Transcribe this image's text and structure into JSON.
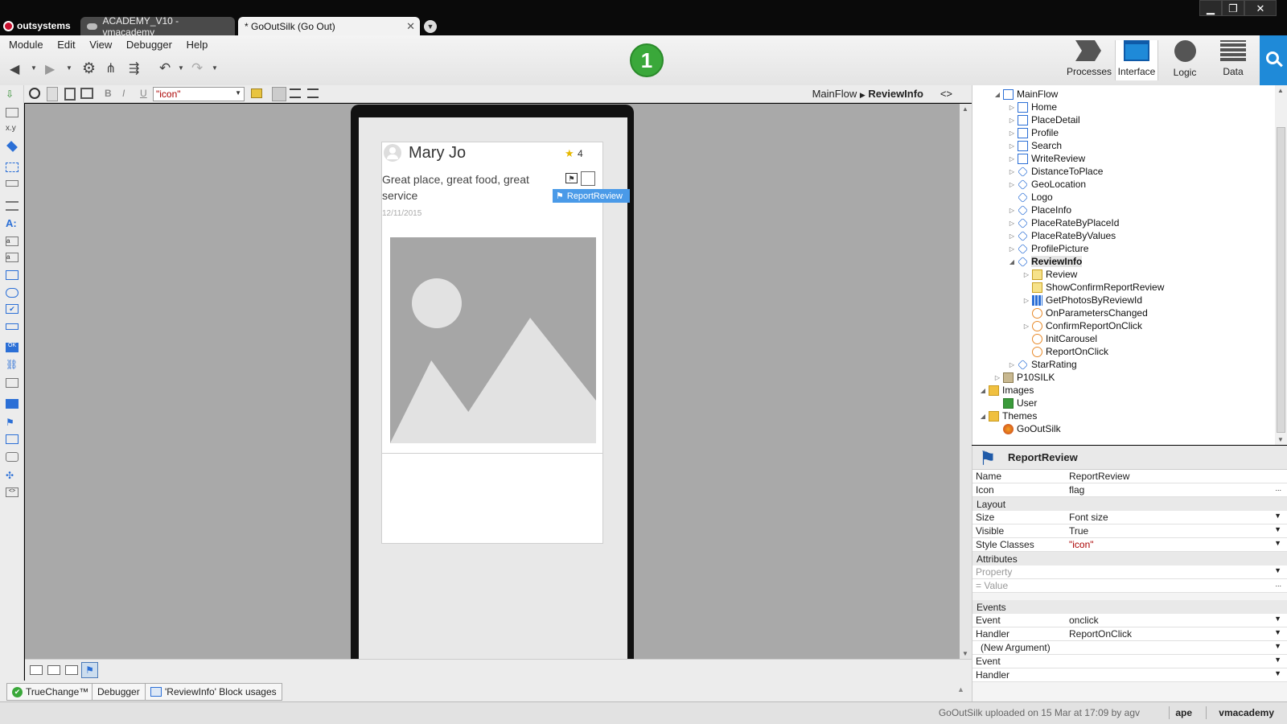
{
  "app": {
    "brand": "outsystems",
    "accent": "#1f8ad8",
    "brand_color": "#c8102e"
  },
  "tabs": [
    {
      "label": "ACADEMY_V10 - vmacademy"
    },
    {
      "label": "* GoOutSilk (Go Out)"
    }
  ],
  "menu": {
    "module": "Module",
    "edit": "Edit",
    "view": "View",
    "debugger": "Debugger",
    "help": "Help"
  },
  "badge": {
    "value": "1",
    "color": "#3aa83a"
  },
  "topnav": [
    {
      "label": "Processes",
      "icon": "processes-icon"
    },
    {
      "label": "Interface",
      "icon": "interface-icon"
    },
    {
      "label": "Logic",
      "icon": "logic-icon"
    },
    {
      "label": "Data",
      "icon": "data-icon"
    }
  ],
  "format_bar": {
    "style_value": "\"icon\"",
    "bold": "B",
    "italic": "I",
    "underline": "U"
  },
  "breadcrumb": {
    "flow": "MainFlow",
    "current": "ReviewInfo",
    "toggle": "<>"
  },
  "preview": {
    "user_name": "Mary Jo",
    "rating": "4",
    "review_text": "Great place, great food, great service",
    "date": "12/11/2015",
    "selected_widget": "ReportReview"
  },
  "tree": [
    {
      "label": "MainFlow",
      "level": 1,
      "icon": "page",
      "twisty": "open"
    },
    {
      "label": "Home",
      "level": 2,
      "icon": "page",
      "twisty": "closed"
    },
    {
      "label": "PlaceDetail",
      "level": 2,
      "icon": "page",
      "twisty": "closed"
    },
    {
      "label": "Profile",
      "level": 2,
      "icon": "page",
      "twisty": "closed"
    },
    {
      "label": "Search",
      "level": 2,
      "icon": "page",
      "twisty": "closed"
    },
    {
      "label": "WriteReview",
      "level": 2,
      "icon": "page",
      "twisty": "closed"
    },
    {
      "label": "DistanceToPlace",
      "level": 2,
      "icon": "block",
      "twisty": "closed"
    },
    {
      "label": "GeoLocation",
      "level": 2,
      "icon": "block",
      "twisty": "closed"
    },
    {
      "label": "Logo",
      "level": 2,
      "icon": "block",
      "twisty": ""
    },
    {
      "label": "PlaceInfo",
      "level": 2,
      "icon": "block",
      "twisty": "closed"
    },
    {
      "label": "PlaceRateByPlaceId",
      "level": 2,
      "icon": "block",
      "twisty": "closed"
    },
    {
      "label": "PlaceRateByValues",
      "level": 2,
      "icon": "block",
      "twisty": "closed"
    },
    {
      "label": "ProfilePicture",
      "level": 2,
      "icon": "block",
      "twisty": "closed"
    },
    {
      "label": "ReviewInfo",
      "level": 2,
      "icon": "block",
      "twisty": "open",
      "selected": true
    },
    {
      "label": "Review",
      "level": 3,
      "icon": "input",
      "twisty": "closed"
    },
    {
      "label": "ShowConfirmReportReview",
      "level": 3,
      "icon": "input",
      "twisty": ""
    },
    {
      "label": "GetPhotosByReviewId",
      "level": 3,
      "icon": "agg",
      "twisty": "closed"
    },
    {
      "label": "OnParametersChanged",
      "level": 3,
      "icon": "action",
      "twisty": ""
    },
    {
      "label": "ConfirmReportOnClick",
      "level": 3,
      "icon": "action",
      "twisty": "closed"
    },
    {
      "label": "InitCarousel",
      "level": 3,
      "icon": "action",
      "twisty": ""
    },
    {
      "label": "ReportOnClick",
      "level": 3,
      "icon": "action",
      "twisty": ""
    },
    {
      "label": "StarRating",
      "level": 2,
      "icon": "block",
      "twisty": "closed"
    },
    {
      "label": "P10SILK",
      "level": 1,
      "icon": "mod",
      "twisty": "closed"
    },
    {
      "label": "Images",
      "level": 0,
      "icon": "folder",
      "twisty": "open"
    },
    {
      "label": "User",
      "level": 1,
      "icon": "img",
      "twisty": ""
    },
    {
      "label": "Themes",
      "level": 0,
      "icon": "folder",
      "twisty": "open"
    },
    {
      "label": "GoOutSilk",
      "level": 1,
      "icon": "theme",
      "twisty": ""
    }
  ],
  "properties": {
    "title": "ReportReview",
    "name_label": "Name",
    "name_value": "ReportReview",
    "icon_label": "Icon",
    "icon_value": "flag",
    "layout_section": "Layout",
    "size_label": "Size",
    "size_value": "Font size",
    "visible_label": "Visible",
    "visible_value": "True",
    "style_label": "Style Classes",
    "style_value": "\"icon\"",
    "attributes_section": "Attributes",
    "property_placeholder": "Property",
    "value_placeholder": "=  Value",
    "events_section": "Events",
    "event_label": "Event",
    "event_value": "onclick",
    "handler_label": "Handler",
    "handler_value": "ReportOnClick",
    "new_argument": "(New Argument)",
    "event2_label": "Event",
    "handler2_label": "Handler",
    "more": "..."
  },
  "bottom_tabs": [
    {
      "label": "TrueChange™"
    },
    {
      "label": "Debugger"
    },
    {
      "label": "'ReviewInfo' Block usages"
    }
  ],
  "status": {
    "upload": "GoOutSilk uploaded on 15 Mar at 17:09 by agv",
    "user": "ape",
    "server": "vmacademy"
  }
}
